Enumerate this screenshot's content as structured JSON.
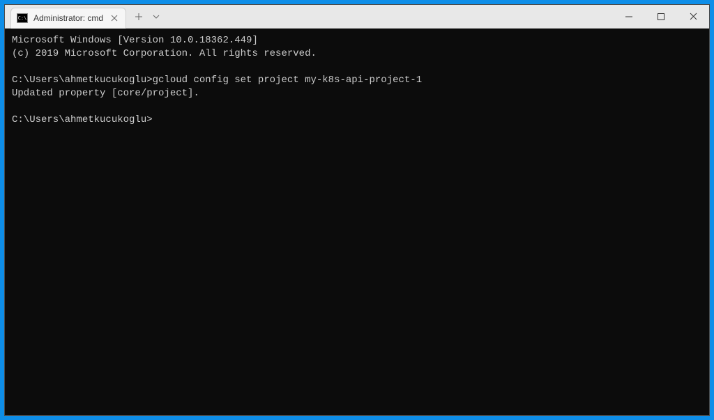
{
  "tab": {
    "title": "Administrator: cmd",
    "icon_text": "C:\\"
  },
  "terminal": {
    "lines": [
      "Microsoft Windows [Version 10.0.18362.449]",
      "(c) 2019 Microsoft Corporation. All rights reserved.",
      "",
      "C:\\Users\\ahmetkucukoglu>gcloud config set project my-k8s-api-project-1",
      "Updated property [core/project].",
      "",
      "C:\\Users\\ahmetkucukoglu>"
    ]
  }
}
